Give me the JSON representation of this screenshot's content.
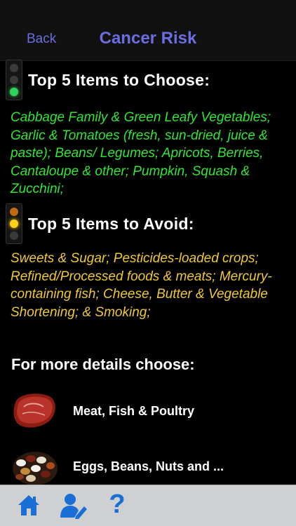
{
  "nav": {
    "back_label": "Back",
    "title": "Cancer Risk"
  },
  "choose": {
    "heading": "Top 5 Items to Choose:",
    "text": "Cabbage Family & Green Leafy Vegetables; Garlic & Tomatoes (fresh, sun-dried, juice & paste); Beans/ Legumes; Apricots, Berries, Cantaloupe & other; Pumpkin, Squash & Zucchini;",
    "icon": "traffic-light-green-icon",
    "color": "#31e631"
  },
  "avoid": {
    "heading": "Top 5 Items to Avoid:",
    "text": "Sweets & Sugar; Pesticides-loaded crops; Refined/Processed foods & meats; Mercury-containing fish; Cheese, Butter & Vegetable Shortening; & Smoking;",
    "icon": "traffic-light-amber-icon",
    "color": "#f0c833"
  },
  "details": {
    "heading": "For more details choose:",
    "items": [
      {
        "label": "Meat, Fish & Poultry",
        "icon": "steak-icon"
      },
      {
        "label": "Eggs, Beans, Nuts and ...",
        "icon": "beans-icon"
      }
    ]
  },
  "tabbar": {
    "accent": "#1a6fd6",
    "items": [
      {
        "icon": "home-icon"
      },
      {
        "icon": "user-edit-icon"
      },
      {
        "icon": "help-icon"
      }
    ]
  }
}
